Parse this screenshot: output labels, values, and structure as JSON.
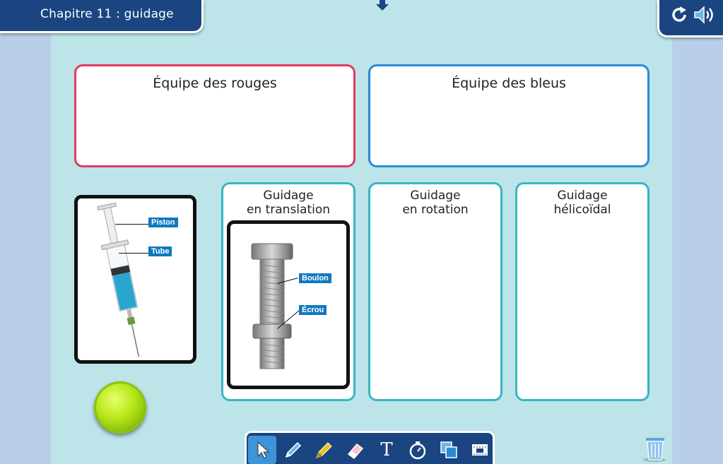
{
  "header": {
    "title": "Chapitre 11 : guidage"
  },
  "teams": [
    {
      "name": "Équipe des rouges",
      "color": "#e03a5f"
    },
    {
      "name": "Équipe des bleus",
      "color": "#2a8ad6"
    }
  ],
  "categories": [
    {
      "line1": "Guidage",
      "line2": "en translation"
    },
    {
      "line1": "Guidage",
      "line2": "en rotation"
    },
    {
      "line1": "Guidage",
      "line2": "hélicoïdal"
    }
  ],
  "cards": {
    "syringe": {
      "labels": [
        "Piston",
        "Tube"
      ]
    },
    "bolt": {
      "labels": [
        "Boulon",
        "Écrou"
      ]
    }
  },
  "toolbar": {
    "tools": [
      "pointer-icon",
      "pencil-icon",
      "highlighter-icon",
      "eraser-icon",
      "text-icon",
      "timer-icon",
      "layers-icon",
      "mask-icon"
    ]
  },
  "icons": {
    "reload": "reload-icon",
    "sound": "speaker-icon",
    "trash": "trash-icon",
    "down": "arrow-down-icon"
  }
}
